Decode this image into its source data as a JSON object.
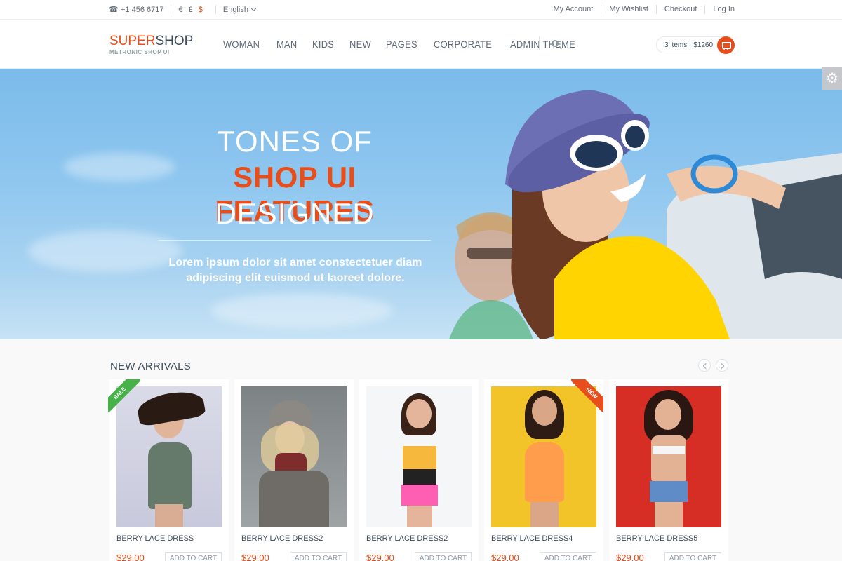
{
  "topbar": {
    "phone": "+1 456 6717",
    "currencies": [
      "€",
      "£",
      "$"
    ],
    "language": "English",
    "links": [
      "My Account",
      "My Wishlist",
      "Checkout",
      "Log In"
    ]
  },
  "header": {
    "logo_part1": "SUPER",
    "logo_part2": "SHOP",
    "logo_sub": "METRONIC SHOP UI",
    "nav": [
      "WOMAN",
      "MAN",
      "KIDS",
      "NEW",
      "PAGES",
      "CORPORATE",
      "ADMIN THEME"
    ],
    "cart_items": "3 items",
    "cart_total": "$1260"
  },
  "hero": {
    "line1": "TONES OF",
    "line2": "SHOP UI FEATURES",
    "line3": "DESIGNED",
    "text_line1": "Lorem ipsum dolor sit amet constectetuer diam",
    "text_line2": "adipiscing elit euismod ut laoreet dolore."
  },
  "arrivals": {
    "title": "NEW ARRIVALS",
    "products": [
      {
        "name": "BERRY LACE DRESS",
        "price": "$29.00",
        "button": "ADD TO CART",
        "badge": "SALE"
      },
      {
        "name": "BERRY LACE DRESS2",
        "price": "$29.00",
        "button": "ADD TO CART",
        "badge": ""
      },
      {
        "name": "BERRY LACE DRESS2",
        "price": "$29.00",
        "button": "ADD TO CART",
        "badge": ""
      },
      {
        "name": "BERRY LACE DRESS4",
        "price": "$29.00",
        "button": "ADD TO CART",
        "badge": "NEW"
      },
      {
        "name": "BERRY LACE DRESS5",
        "price": "$29.00",
        "button": "ADD TO CART",
        "badge": ""
      }
    ]
  },
  "colors": {
    "accent": "#e84d1c",
    "sale": "#48b24a",
    "sky": "#8ec6ef"
  }
}
